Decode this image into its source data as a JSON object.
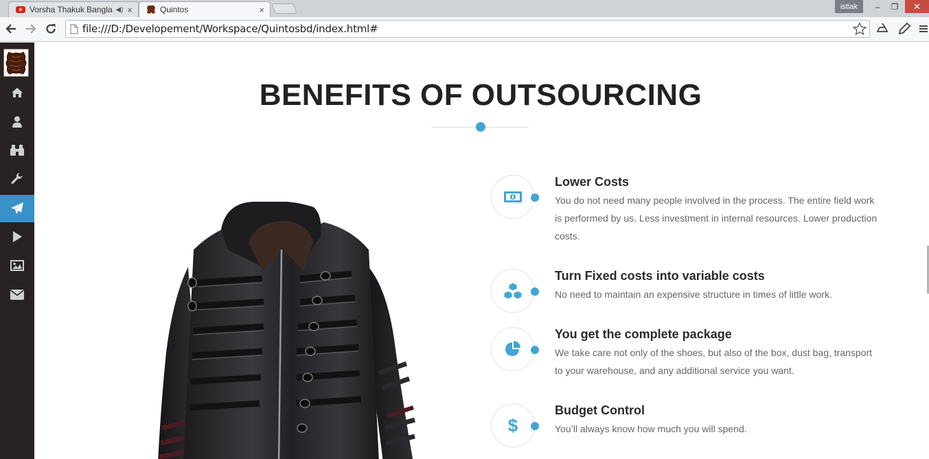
{
  "browser": {
    "tabs": [
      {
        "title": "Vorsha Thakuk Bangla",
        "close": "×"
      },
      {
        "title": "Quintos",
        "close": "×"
      }
    ],
    "user": "istiak",
    "window": {
      "minimize": "–",
      "restore": "❐",
      "close": "✕"
    },
    "url": "file:///D:/Developement/Workspace/Quintosbd/index.html#"
  },
  "sidebar": {
    "items": [
      {
        "name": "home",
        "icon": "home-icon"
      },
      {
        "name": "about",
        "icon": "user-icon"
      },
      {
        "name": "search",
        "icon": "binoculars-icon"
      },
      {
        "name": "services",
        "icon": "wrench-icon"
      },
      {
        "name": "outsourcing",
        "icon": "paper-plane-icon",
        "active": true
      },
      {
        "name": "video",
        "icon": "play-icon"
      },
      {
        "name": "gallery",
        "icon": "picture-icon"
      },
      {
        "name": "contact",
        "icon": "envelope-icon"
      }
    ],
    "active_color": "#3891c9",
    "background": "#292222"
  },
  "section": {
    "title": "BENEFITS OF OUTSOURCING",
    "accent_color": "#42a5d5"
  },
  "benefits": [
    {
      "title": "Lower Costs",
      "text": "You do not need many people involved in the process. The entire field work is performed by us. Less investment in internal resources. Lower production costs.",
      "icon": "money-icon"
    },
    {
      "title": "Turn Fixed costs into variable costs",
      "text": "No need to maintain an expensive structure in times of little work.",
      "icon": "cubes-icon"
    },
    {
      "title": "You get the complete package",
      "text": "We take care not only of the shoes, but also of the box, dust bag, transport to your warehouse, and any additional service you want.",
      "icon": "pie-chart-icon"
    },
    {
      "title": "Budget Control",
      "text": "You’ll always know how much you will spend.",
      "icon": "dollar-icon"
    }
  ]
}
